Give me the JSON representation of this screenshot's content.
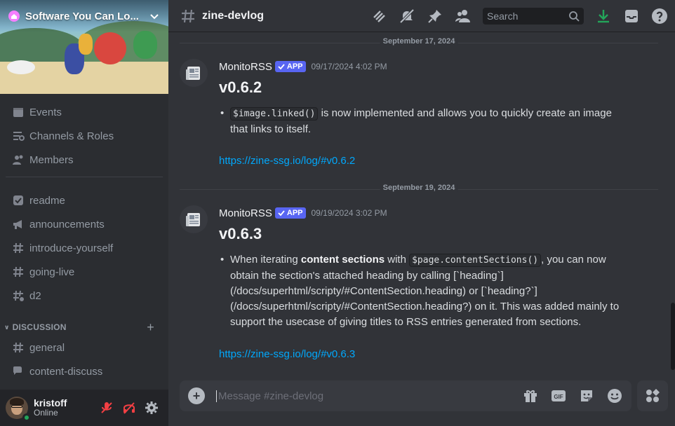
{
  "server": {
    "name": "Software You Can Lo..."
  },
  "sidebar": {
    "nav": [
      {
        "label": "Events",
        "icon": "calendar-icon"
      },
      {
        "label": "Channels & Roles",
        "icon": "channels-roles-icon"
      },
      {
        "label": "Members",
        "icon": "members-icon"
      }
    ],
    "channels": [
      {
        "label": "readme",
        "icon": "checkbox-icon"
      },
      {
        "label": "announcements",
        "icon": "megaphone-icon"
      },
      {
        "label": "introduce-yourself",
        "icon": "hash-icon"
      },
      {
        "label": "going-live",
        "icon": "hash-icon"
      },
      {
        "label": "d2",
        "icon": "hash-thread-icon"
      }
    ],
    "category": {
      "label": "DISCUSSION"
    },
    "category_channels": [
      {
        "label": "general",
        "icon": "hash-icon"
      },
      {
        "label": "content-discuss",
        "icon": "forum-icon"
      }
    ]
  },
  "user": {
    "name": "kristoff",
    "status": "Online"
  },
  "header": {
    "channel": "zine-devlog",
    "search_placeholder": "Search"
  },
  "messages": [
    {
      "date": "September 17, 2024",
      "author": "MonitoRSS",
      "tag": "APP",
      "timestamp": "09/17/2024 4:02 PM",
      "version": "v0.6.2",
      "code": "$image.linked()",
      "text": " is now implemented and allows you to quickly create an image that links to itself.",
      "link": "https://zine-ssg.io/log/#v0.6.2"
    },
    {
      "date": "September 19, 2024",
      "author": "MonitoRSS",
      "tag": "APP",
      "timestamp": "09/19/2024 3:02 PM",
      "version": "v0.6.3",
      "pre": "When iterating ",
      "bold": "content sections",
      "mid": " with ",
      "code": "$page.contentSections()",
      "text": ", you can now obtain the section's attached heading by calling [`heading`](/docs/superhtml/scripty/#ContentSection.heading) or [`heading?`](/docs/superhtml/scripty/#ContentSection.heading?) on it. This was added mainly to support the usecase of giving titles to RSS entries generated from sections.",
      "link": "https://zine-ssg.io/log/#v0.6.3"
    }
  ],
  "composer": {
    "placeholder": "Message #zine-devlog"
  },
  "colors": {
    "accent": "#5865f2",
    "link": "#00a8fc",
    "online": "#23a55a",
    "mute_red": "#f23f43",
    "download_green": "#23a55a"
  }
}
